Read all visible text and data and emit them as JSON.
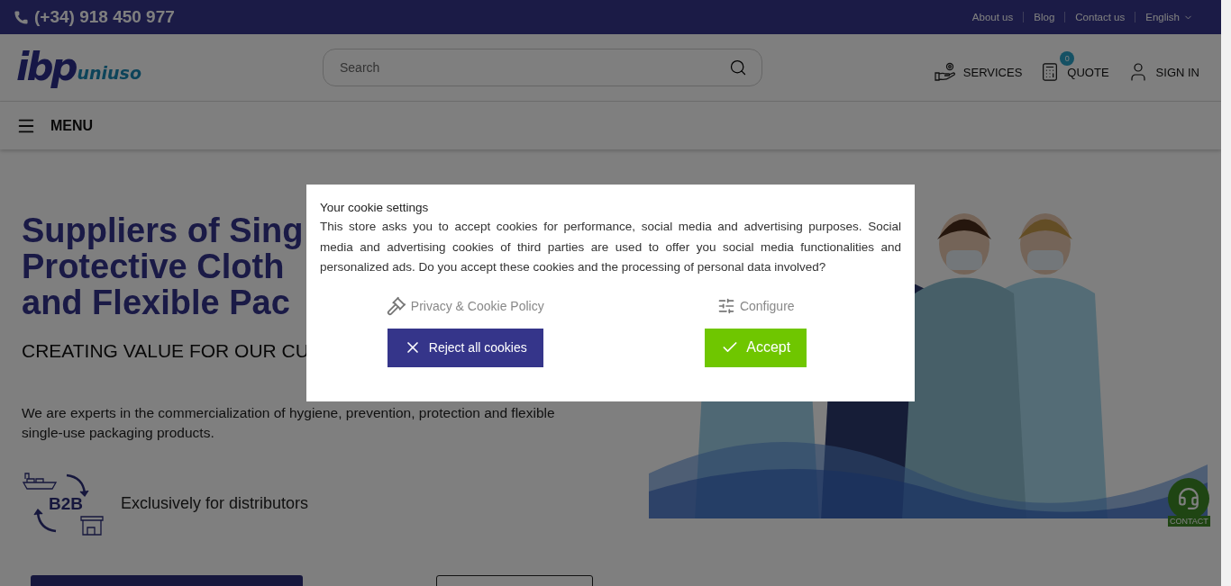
{
  "top_bar": {
    "phone": "(+34) 918 450 977",
    "links": [
      "About us",
      "Blog",
      "Contact us"
    ],
    "language": "English"
  },
  "header": {
    "logo": {
      "main": "ibp",
      "sub": "uniuso"
    },
    "search": {
      "placeholder": "Search"
    },
    "actions": [
      {
        "kind": "services",
        "label": "SERVICES"
      },
      {
        "kind": "quote",
        "label": "QUOTE",
        "badge": "0"
      },
      {
        "kind": "signin",
        "label": "SIGN IN"
      }
    ]
  },
  "menu": {
    "label": "MENU"
  },
  "hero": {
    "title_lines": [
      "Suppliers of Sing",
      "Protective Cloth",
      "and Flexible Pac"
    ],
    "subtitle": "CREATING VALUE FOR OUR CU",
    "description": "We are experts in the commercialization of hygiene, prevention, protection and flexible single-use packaging products.",
    "b2b": {
      "badge": "B2B",
      "label": "Exclusively for distributors"
    }
  },
  "contact": {
    "label": "CONTACT"
  },
  "cookie_dialog": {
    "title": "Your cookie settings",
    "text": "This store asks you to accept cookies for performance, social media and advertising purposes. Social media and advertising cookies of third parties are used to offer you social media functionalities and personalized ads. Do you accept these cookies and the processing of personal data involved?",
    "links": [
      {
        "kind": "policy",
        "label": "Privacy & Cookie Policy"
      },
      {
        "kind": "configure",
        "label": "Configure"
      }
    ],
    "buttons": [
      {
        "kind": "reject",
        "label": "Reject all cookies"
      },
      {
        "kind": "accept",
        "label": "Accept"
      }
    ]
  }
}
